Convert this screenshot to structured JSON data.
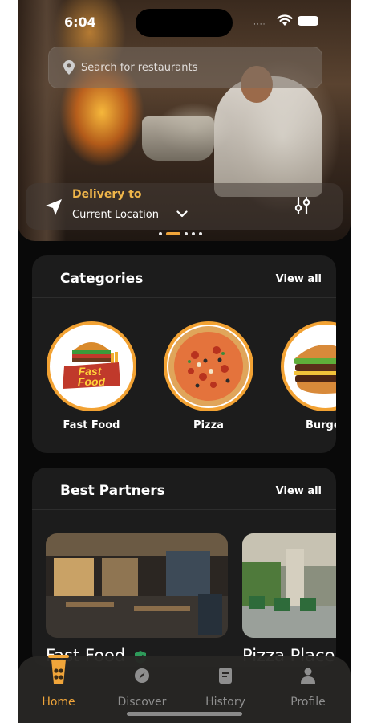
{
  "status_bar": {
    "time": "6:04",
    "signal": "····"
  },
  "search": {
    "placeholder": "Search for restaurants",
    "icon": "location-pin-icon"
  },
  "delivery": {
    "label": "Delivery to",
    "location": "Current Location"
  },
  "carousel": {
    "total": 5,
    "active_index": 1
  },
  "categories": {
    "title": "Categories",
    "view_all": "View all",
    "items": [
      {
        "name": "Fast Food",
        "logo_line1": "Fast",
        "logo_line2": "Food"
      },
      {
        "name": "Pizza"
      },
      {
        "name": "Burger"
      }
    ]
  },
  "partners": {
    "title": "Best Partners",
    "view_all": "View all",
    "items": [
      {
        "name": "Fast Food"
      },
      {
        "name": "Pizza Place"
      }
    ]
  },
  "tabs": [
    {
      "label": "Home",
      "icon": "home-icon",
      "active": true
    },
    {
      "label": "Discover",
      "icon": "compass-icon",
      "active": false
    },
    {
      "label": "History",
      "icon": "history-icon",
      "active": false
    },
    {
      "label": "Profile",
      "icon": "profile-icon",
      "active": false
    }
  ],
  "colors": {
    "accent": "#f0a53a",
    "background": "#090909",
    "card": "#1c1c1c"
  }
}
